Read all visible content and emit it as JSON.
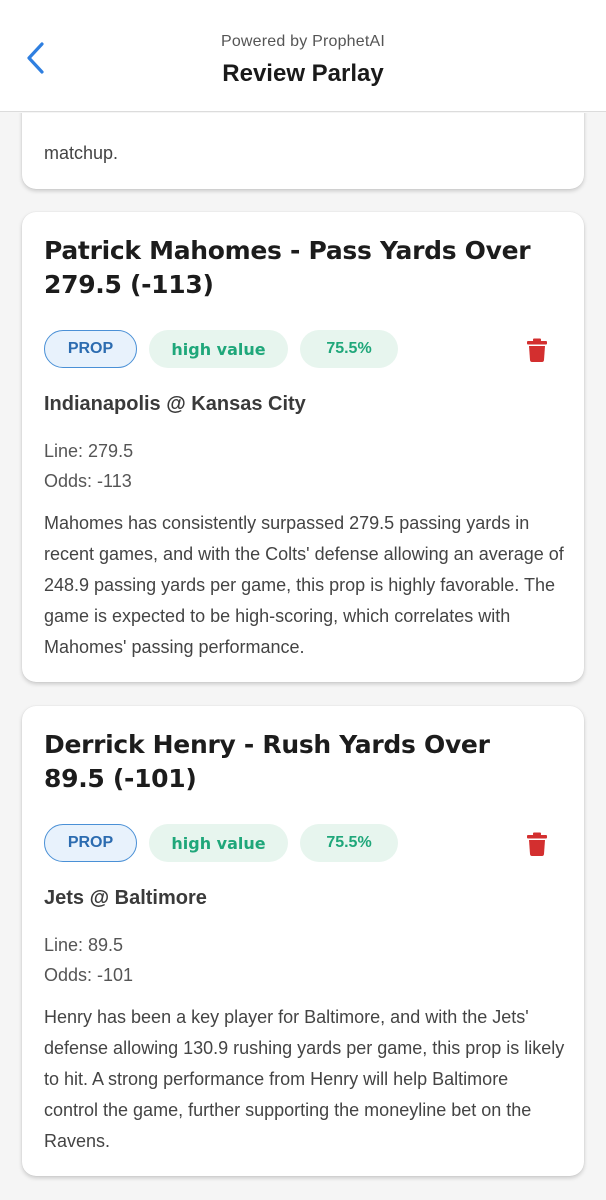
{
  "header": {
    "powered_by": "Powered by ProphetAI",
    "title": "Review Parlay",
    "accent": "#2f7fe0"
  },
  "previous_card": {
    "tail_text": "matchup."
  },
  "picks": [
    {
      "title": "Patrick Mahomes - Pass Yards Over 279.5 (-113)",
      "type_chip": "PROP",
      "value_chip": "high value",
      "confidence_chip": "75.5%",
      "matchup": "Indianapolis @ Kansas City",
      "line": "Line: 279.5",
      "odds": "Odds: -113",
      "description": "Mahomes has consistently surpassed 279.5 passing yards in recent games, and with the Colts' defense allowing an average of 248.9 passing yards per game, this prop is highly favorable. The game is expected to be high-scoring, which correlates with Mahomes' passing performance."
    },
    {
      "title": "Derrick Henry - Rush Yards Over 89.5 (-101)",
      "type_chip": "PROP",
      "value_chip": "high value",
      "confidence_chip": "75.5%",
      "matchup": "Jets @ Baltimore",
      "line": "Line: 89.5",
      "odds": "Odds: -101",
      "description": "Henry has been a key player for Baltimore, and with the Jets' defense allowing 130.9 rushing yards per game, this prop is likely to hit. A strong performance from Henry will help Baltimore control the game, further supporting the moneyline bet on the Ravens."
    }
  ],
  "icons": {
    "back": "chevron-left-icon",
    "delete": "trash-icon"
  },
  "colors": {
    "delete": "#d32f2f",
    "prop_chip": "#2c6cb0",
    "value_chip": "#1fa77a"
  }
}
